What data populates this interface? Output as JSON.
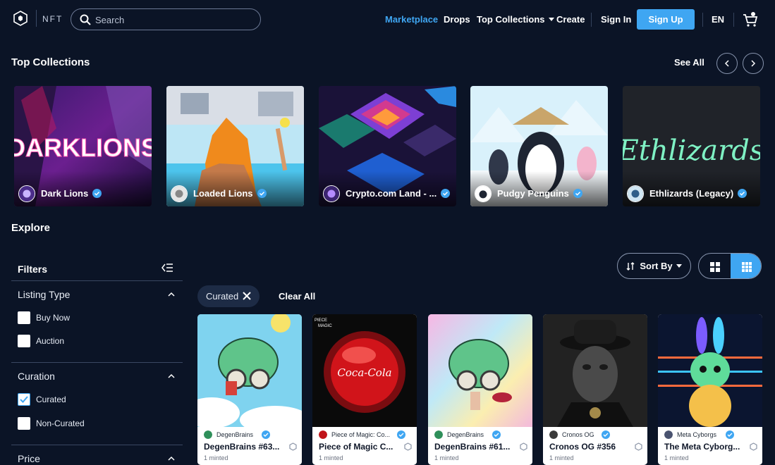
{
  "header": {
    "logo_text": "NFT",
    "search_placeholder": "Search",
    "nav": [
      "Marketplace",
      "Drops",
      "Top Collections",
      "Create"
    ],
    "sign_in": "Sign In",
    "sign_up": "Sign Up",
    "language": "EN"
  },
  "top_collections": {
    "title": "Top Collections",
    "see_all": "See All",
    "items": [
      {
        "name": "Dark Lions",
        "art_text": "DARKLIONS"
      },
      {
        "name": "Loaded Lions"
      },
      {
        "name": "Crypto.com Land - ..."
      },
      {
        "name": "Pudgy Penguins"
      },
      {
        "name": "Ethlizards (Legacy)",
        "art_text": "Ethlizards"
      }
    ]
  },
  "explore": {
    "title": "Explore",
    "filters_title": "Filters",
    "groups": [
      {
        "title": "Listing Type",
        "options": [
          {
            "label": "Buy Now",
            "checked": false
          },
          {
            "label": "Auction",
            "checked": false
          }
        ]
      },
      {
        "title": "Curation",
        "options": [
          {
            "label": "Curated",
            "checked": true
          },
          {
            "label": "Non-Curated",
            "checked": false
          }
        ]
      },
      {
        "title": "Price"
      }
    ],
    "sort_by": "Sort By",
    "active_chip": "Curated",
    "clear_all": "Clear All"
  },
  "nfts": [
    {
      "collection": "DegenBrains",
      "name": "DegenBrains #63...",
      "minted": "1 minted"
    },
    {
      "collection": "Piece of Magic: Co...",
      "name": "Piece of Magic C...",
      "minted": "1 minted",
      "art_text": "PIECE\nMAGIC"
    },
    {
      "collection": "DegenBrains",
      "name": "DegenBrains #61...",
      "minted": "1 minted"
    },
    {
      "collection": "Cronos OG",
      "name": "Cronos OG #356",
      "minted": "1 minted"
    },
    {
      "collection": "Meta Cyborgs",
      "name": "The Meta Cyborg...",
      "minted": "1 minted"
    }
  ],
  "colors": {
    "background": "#0b1426",
    "accent": "#3fa6f2"
  }
}
